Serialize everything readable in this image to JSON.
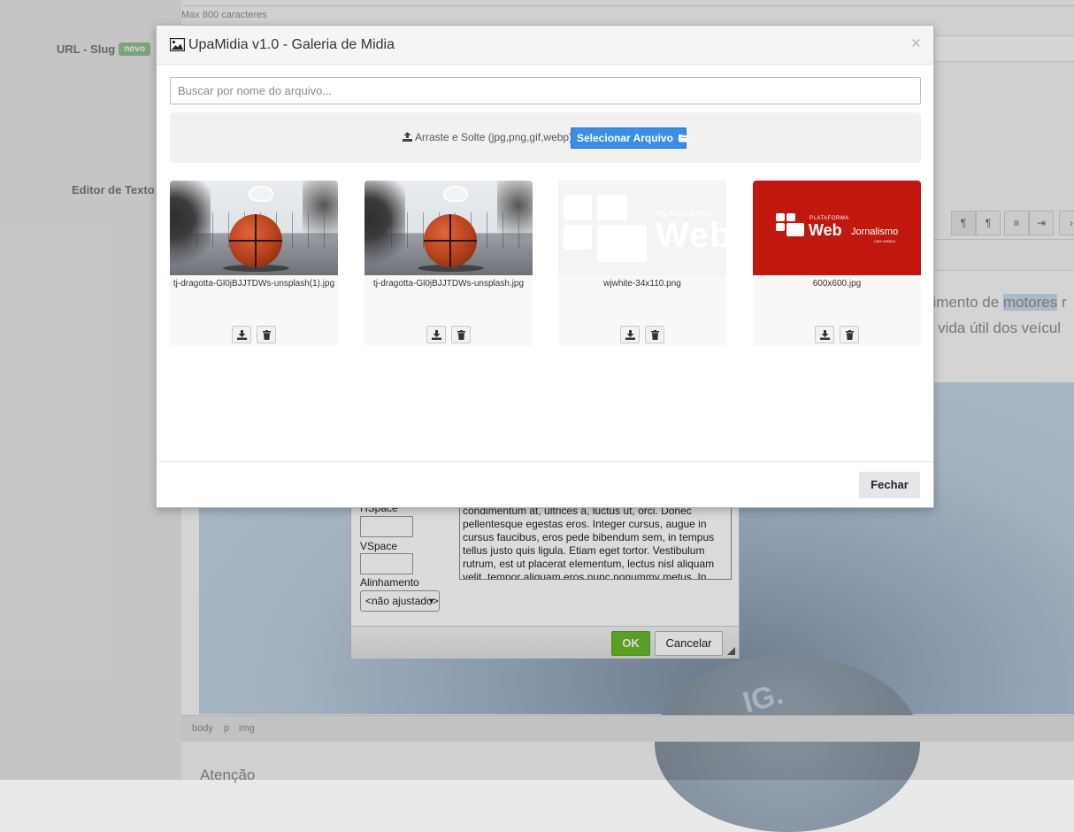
{
  "background": {
    "hint": "Max 800 caracteres",
    "slug_label": "URL - Slug",
    "slug_badge": "novo",
    "editor_label": "Editor de Texto",
    "editor_line1_pre": "vimento de ",
    "editor_line1_highlight": "motores",
    "editor_line1_post": " r",
    "editor_line2": "a vida útil dos veícul",
    "toolbar": [
      "¶",
      "¶",
      "¶"
    ],
    "statusbar": [
      "body",
      "p",
      "img"
    ],
    "atencao": "Atenção",
    "image_watermark": "IG."
  },
  "image_dialog": {
    "hspace_label": "HSpace",
    "vspace_label": "VSpace",
    "align_label": "Alinhamento",
    "align_value": "<não ajustado>",
    "preview_text": "condimentum at, ultrices a, luctus ut, orci. Donec pellentesque egestas eros. Integer cursus, augue in cursus faucibus, eros pede bibendum sem, in tempus tellus justo quis ligula. Etiam eget tortor. Vestibulum rutrum, est ut placerat elementum, lectus nisl aliquam velit, tempor aliquam eros nunc nonummy metus. In",
    "ok_label": "OK",
    "cancel_label": "Cancelar"
  },
  "modal": {
    "title": "UpaMidia v1.0 - Galeria de Midia",
    "close_label": "×",
    "search_placeholder": "Buscar por nome do arquivo...",
    "dropzone_text": "Arraste e Solte (jpg,png,gif,webp)",
    "select_button": "Selecionar Arquivo",
    "close_button": "Fechar",
    "files": [
      {
        "name": "tj-dragotta-Gl0jBJJTDWs-unsplash(1).jpg",
        "thumb": "basketball-photo"
      },
      {
        "name": "tj-dragotta-Gl0jBJJTDWs-unsplash.jpg",
        "thumb": "basketball-photo"
      },
      {
        "name": "wjwhite-34x110.png",
        "thumb": "white-logo",
        "logo_small": "PLATAFORMA",
        "logo_big": "Web"
      },
      {
        "name": "600x600.jpg",
        "thumb": "red-logo",
        "logo_small": "PLATAFORMA",
        "logo_big": "Web",
        "logo_suffix": "Jornalismo",
        "logo_tiny": "CMS WEBSC"
      }
    ]
  },
  "colors": {
    "primary_button": "#3a8ee6",
    "ok_button": "#6ab82c",
    "red_logo_bg": "#c0170f"
  },
  "icons": [
    "image-icon",
    "upload-icon",
    "folder-open-icon",
    "download-icon",
    "trash-icon",
    "close-icon",
    "resize-grip-icon"
  ]
}
